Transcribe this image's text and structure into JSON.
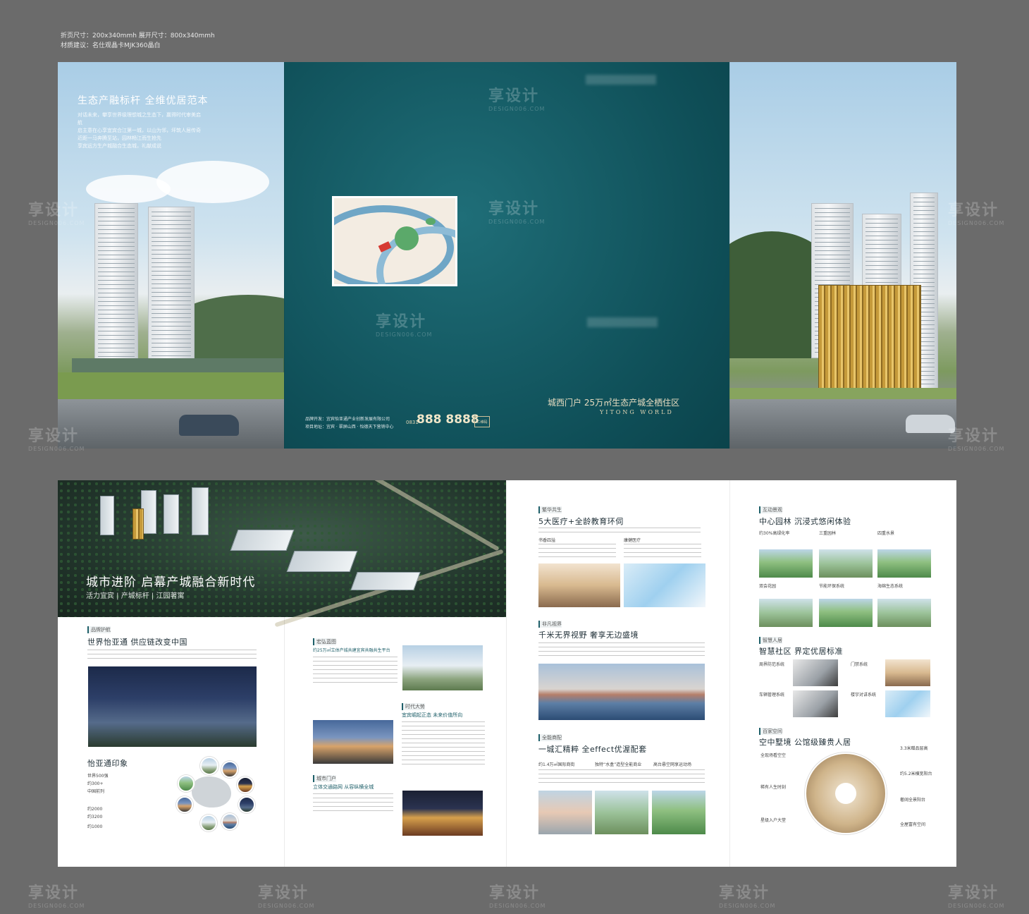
{
  "spec": {
    "line1": "折页尺寸：200x340mmh 展开尺寸：800x340mmh",
    "line1_note": "",
    "line2": "材质建议：名仕观晶卡MJK360晶白"
  },
  "outer": {
    "left_panel": {
      "headline": "生态产融标杆 全维优居范本",
      "body": [
        "对话未来，攀享世界级理想城之生态下，赢得时代审美启航",
        "启主意在心享宜宾合江第一城，以山为邻，坪筑人居传奇",
        "近距一马奔腾至站，园林畅江而生抢先",
        "享宾远方生产城融合生态城，礼献成说"
      ]
    },
    "cover": {
      "slogan": "城西门户 25万㎡生态产城全栖住区",
      "slogan_en": "YITONG WORLD",
      "phone": "888 8888",
      "phone_prefix": "0831",
      "developer": "品牌开发：宜宾怡亚通产业创新发展有限公司",
      "address": "项目地址：宜宾 · 翠屏山西 · 怡德天下营销中心",
      "qr_label": "二维码"
    },
    "watermark": {
      "cn": "享设计",
      "en": "DESIGN006.COM"
    }
  },
  "inner": {
    "hero": {
      "title": "城市进阶 启幕产城融合新时代",
      "subtitle": "活力宜宾 | 产城标杆 | 江园著寓"
    },
    "brand": {
      "tag": "品牌护航",
      "title": "世界怡亚通 供应链改变中国",
      "impression_title": "怡亚通印象",
      "stats": [
        "世界500强",
        "约300+",
        "中国前列",
        "约2000",
        "约3200",
        "约1000"
      ]
    },
    "industry": {
      "tag": "宏弘蓝图",
      "title": "约25万㎡立体产城共建宜宾共融共生平台",
      "era_tag": "时代大势",
      "era_title": "宜宾崛起正态 未来价值所向",
      "gate_tag": "城市门户",
      "gate_title": "立体交通路网 从容纵横全城"
    },
    "education": {
      "tag": "繁华共生",
      "title": "5大医疗+全龄教育环伺",
      "sub_left": "书香四溢",
      "sub_right": "康健医疗",
      "view_tag": "非凡视界",
      "view_title": "千米无界视野 奢享无边盛境",
      "mall_tag": "全能商配",
      "mall_title": "一城汇精粹 全effect优渥配套",
      "mall_items": [
        "约1.4万㎡国际商街",
        "独特“水盒”造型全能商业",
        "高台悬空网享运动场"
      ]
    },
    "garden": {
      "tag": "互动景观",
      "title": "中心园林 沉浸式悠闲体验",
      "items": [
        "约30%高绿化率",
        "三重园林",
        "四重水景",
        "双会花园",
        "节能环保系统",
        "海绵生态系统"
      ],
      "smart_tag": "智慧人居",
      "smart_title": "智慧社区 界定优居标准",
      "smart_items": [
        "周界防范系统",
        "门禁系统",
        "车辆管理系统",
        "楼宇对讲系统"
      ],
      "sky_tag": "百家空间",
      "sky_title": "空中墅境 公馆级臻贵人居",
      "sky_left": [
        "全现场看空空",
        "稀有人生时刻",
        "星级入户大堂"
      ],
      "sky_right": [
        "3.3米赠品层高",
        "约5.2米横宽阳台",
        "奢阔全景阳台",
        "全屋富有空间"
      ]
    }
  },
  "colors": {
    "teal": "#0f4f58",
    "gold": "#c59a3a",
    "accent_text": "#1e5f69"
  }
}
